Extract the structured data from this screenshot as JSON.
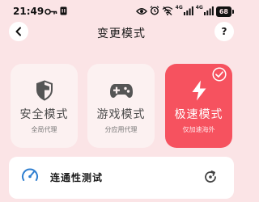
{
  "status_bar": {
    "time": "21:49",
    "net_label_1": "4G",
    "net_label_2": "4G",
    "battery": "68"
  },
  "header": {
    "title": "变更模式",
    "help_label": "?"
  },
  "modes": [
    {
      "title": "安全模式",
      "desc": "全局代理",
      "icon": "shield-icon",
      "selected": false
    },
    {
      "title": "游戏模式",
      "desc": "分应用代理",
      "icon": "gamepad-icon",
      "selected": false
    },
    {
      "title": "极速模式",
      "desc": "仅加速海外",
      "icon": "lightning-icon",
      "selected": true
    }
  ],
  "connectivity": {
    "label": "连通性测试"
  },
  "colors": {
    "background": "#fbe4e6",
    "accent": "#f6525f",
    "card": "#fcf1f1",
    "gauge": "#2f7fd0"
  }
}
